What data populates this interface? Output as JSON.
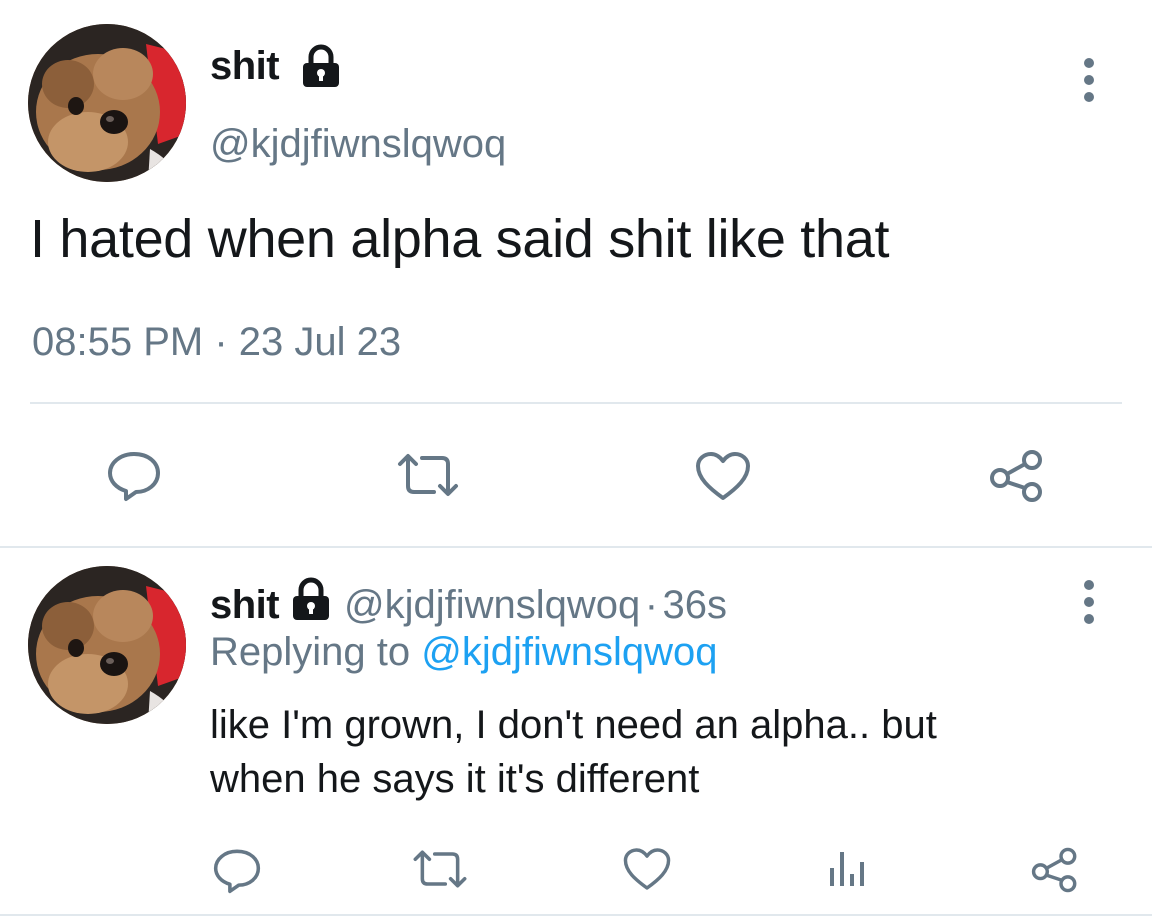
{
  "tweet": {
    "author_name": "shit",
    "handle": "@kjdjfiwnslqwoq",
    "text": "I hated when alpha said shit like that",
    "time": "08:55 PM",
    "separator": "·",
    "date": "23 Jul 23"
  },
  "reply": {
    "author_name": "shit",
    "handle": "@kjdjfiwnslqwoq",
    "separator": "·",
    "age": "36s",
    "replying_prefix": "Replying to",
    "replying_handle": "@kjdjfiwnslqwoq",
    "text_line1": "like I'm grown,  I don't need an alpha.. but",
    "text_line2": "when he says it it's different"
  },
  "icons": {
    "lock": "lock-icon",
    "more": "more-vertical-icon",
    "reply": "reply-icon",
    "retweet": "retweet-icon",
    "like": "heart-icon",
    "analytics": "analytics-icon",
    "share": "share-icon"
  },
  "colors": {
    "text": "#14171a",
    "secondary": "#657786",
    "link": "#1da1f2",
    "divider": "#e1e8ed"
  }
}
